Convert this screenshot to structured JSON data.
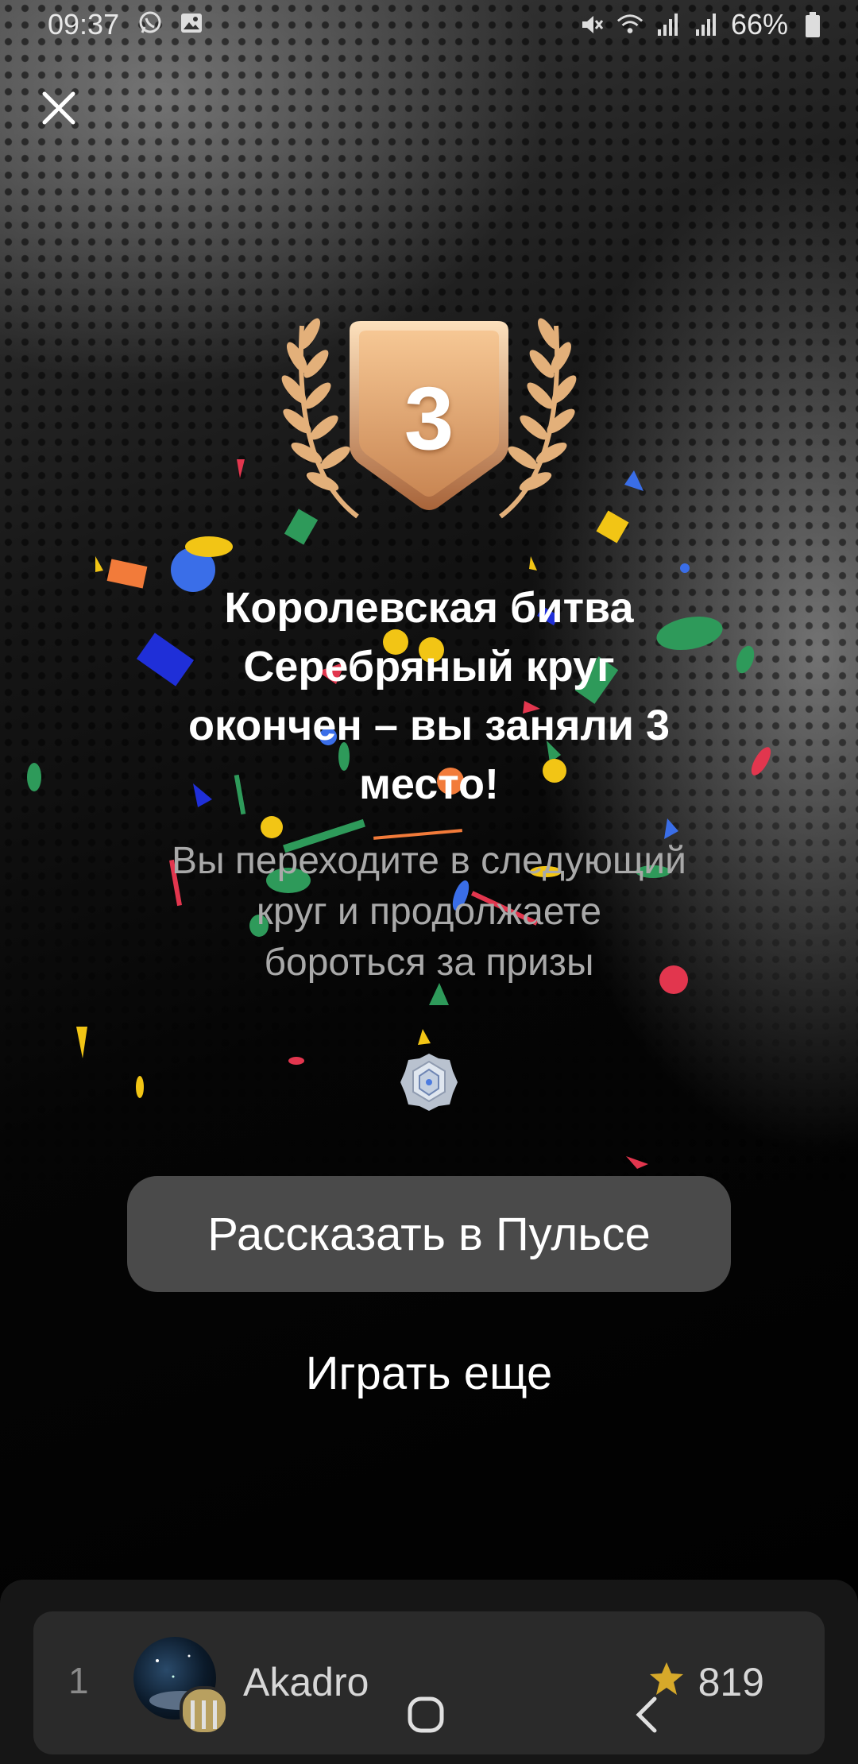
{
  "status_bar": {
    "time": "09:37",
    "battery": "66%",
    "left_icons": [
      "whatsapp-icon",
      "gallery-icon"
    ],
    "right_icons": [
      "mute-icon",
      "wifi-icon",
      "signal-icon",
      "signal-icon",
      "battery-icon"
    ]
  },
  "result": {
    "place_number": "3",
    "title_lines": [
      "Королевская битва",
      "Серебряный круг",
      "окончен – вы заняли 3",
      "место!"
    ],
    "subtitle_lines": [
      "Вы переходите в следующий",
      "круг и продолжаете",
      "бороться за призы"
    ]
  },
  "actions": {
    "share_label": "Рассказать в Пульсе",
    "play_again_label": "Играть еще"
  },
  "leaderboard": {
    "rows": [
      {
        "rank": "1",
        "name": "Akadro",
        "score": "819"
      }
    ]
  },
  "colors": {
    "medal_light": "#f2c08c",
    "medal_dark": "#c98653",
    "laurel": "#e3b07a",
    "button_bg": "#4a4a4a",
    "star": "#d6a92a"
  }
}
